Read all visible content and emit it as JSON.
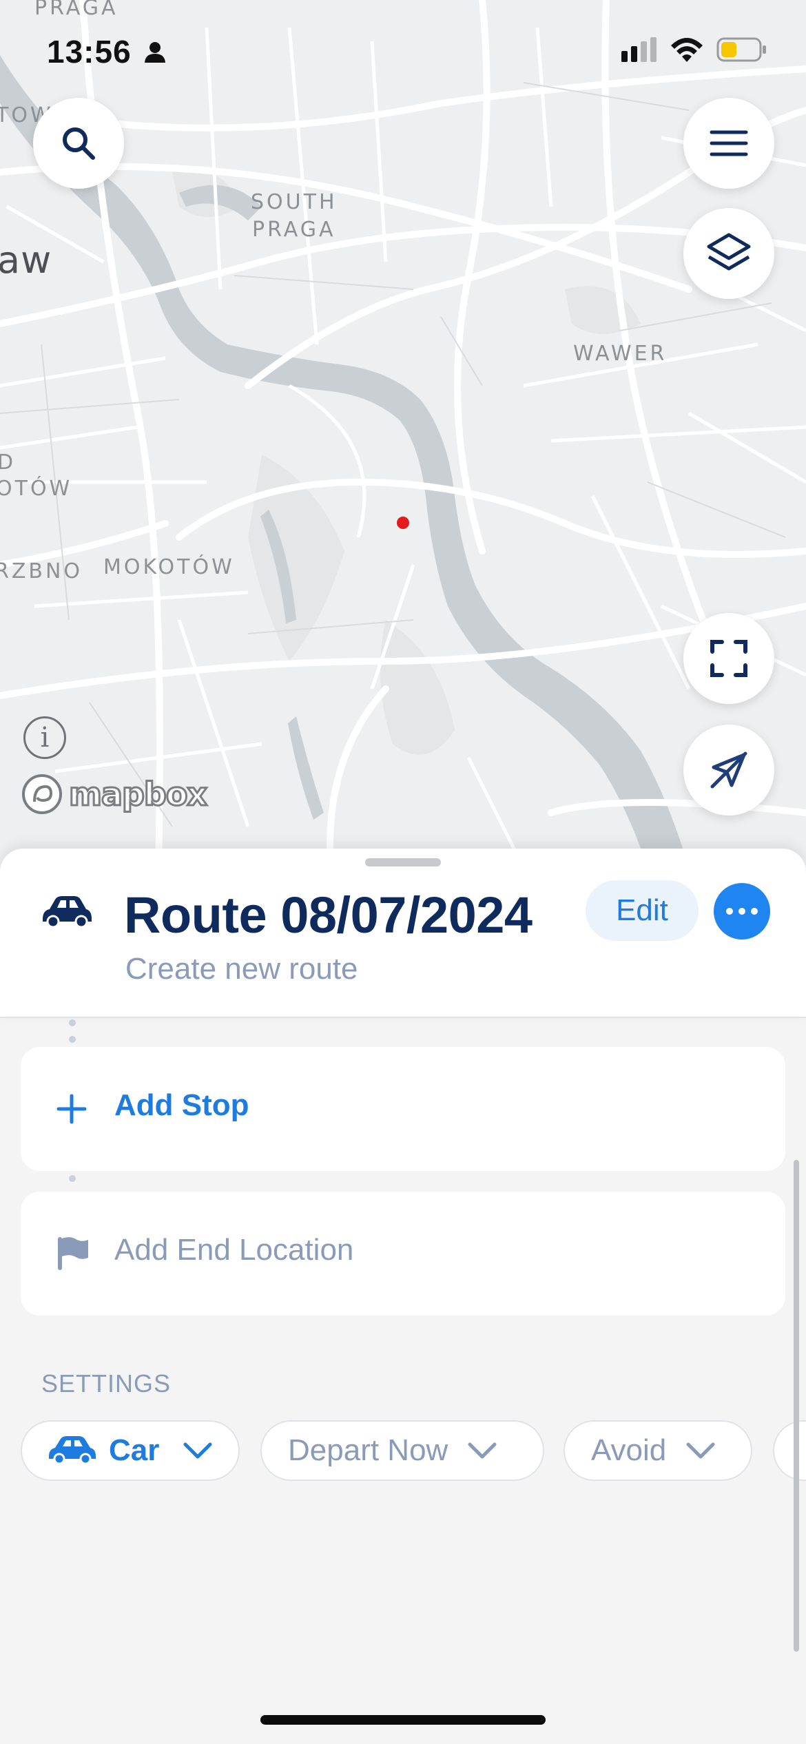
{
  "status_bar": {
    "time": "13:56"
  },
  "map": {
    "labels": {
      "praga": "PRAGA",
      "tow": "TOW",
      "south_praga_1": "SOUTH",
      "south_praga_2": "PRAGA",
      "aw": "aw",
      "wawer": "WAWER",
      "d": "D",
      "otow": "OTÓW",
      "rzbno": "RZBNO",
      "mokotow": "MOKOTÓW"
    },
    "attribution": "mapbox",
    "info_symbol": "i"
  },
  "route": {
    "title": "Route 08/07/2024",
    "subtitle": "Create new route",
    "edit_label": "Edit"
  },
  "stops": {
    "add_stop_label": "Add Stop",
    "add_end_label": "Add End Location"
  },
  "settings": {
    "title": "SETTINGS",
    "chips": [
      {
        "label": "Car"
      },
      {
        "label": "Depart Now"
      },
      {
        "label": "Avoid"
      }
    ]
  },
  "icons": {
    "search": "search-icon",
    "menu": "menu-icon",
    "layers": "layers-icon",
    "fit": "fit-bounds-icon",
    "location": "location-arrow-icon",
    "car": "car-icon",
    "plus": "plus-icon",
    "flag": "flag-icon",
    "chevron": "chevron-down-icon"
  },
  "colors": {
    "accent": "#1e7be0",
    "title": "#0f2a5c",
    "muted": "#8a9bb9",
    "map_bg": "#eeeff0",
    "river": "#c9cfd3",
    "battery": "#f7c600"
  }
}
